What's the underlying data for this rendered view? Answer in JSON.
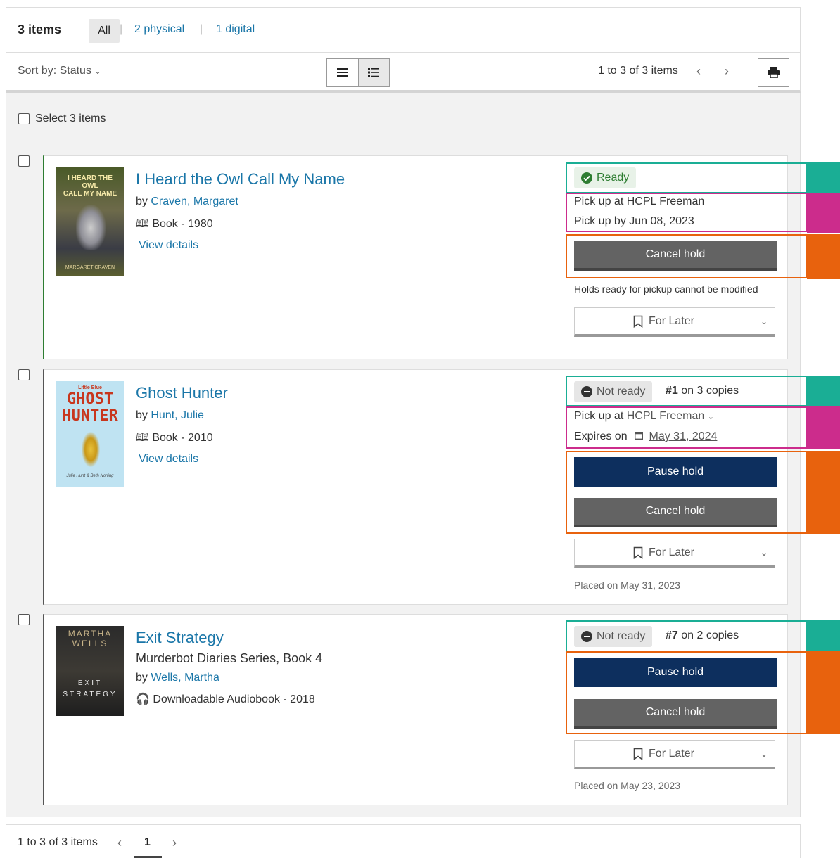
{
  "header": {
    "count": "3 items",
    "filters": {
      "all": "All",
      "physical": "2 physical",
      "digital": "1 digital"
    },
    "sort_label": "Sort by: Status",
    "pagination": "1 to 3 of 3 items"
  },
  "select_all": "Select 3 items",
  "items": [
    {
      "title": "I Heard the Owl Call My Name",
      "by": "by",
      "author": "Craven, Margaret",
      "format": "Book - 1980",
      "view_details": "View details",
      "status": "Ready",
      "pickup": "Pick up at HCPL Freeman",
      "pickup_by": "Pick up by Jun 08, 2023",
      "cancel": "Cancel hold",
      "note": "Holds ready for pickup cannot be modified",
      "for_later": "For Later",
      "cover_text": {
        "top": "I HEARD THE OWL",
        "mid": "CALL MY NAME",
        "bottom": "MARGARET CRAVEN"
      }
    },
    {
      "title": "Ghost Hunter",
      "by": "by",
      "author": "Hunt, Julie",
      "format": "Book - 2010",
      "view_details": "View details",
      "status": "Not ready",
      "queue_num": "#1",
      "queue_rest": "on 3 copies",
      "pickup_prefix": "Pick up at",
      "pickup_location": "HCPL Freeman",
      "expires_label": "Expires on",
      "expires_date": "May 31, 2024",
      "pause": "Pause hold",
      "cancel": "Cancel hold",
      "for_later": "For Later",
      "placed": "Placed on May 31, 2023",
      "cover_text": {
        "series": "Little Blue",
        "line1": "GHOST",
        "line2": "HUNTER",
        "credit": "Julie Hunt & Beth Norling"
      }
    },
    {
      "title": "Exit Strategy",
      "series": "Murderbot Diaries Series, Book 4",
      "by": "by",
      "author": "Wells, Martha",
      "format": "Downloadable Audiobook - 2018",
      "status": "Not ready",
      "queue_num": "#7",
      "queue_rest": "on 2 copies",
      "pause": "Pause hold",
      "cancel": "Cancel hold",
      "for_later": "For Later",
      "placed": "Placed on May 23, 2023",
      "cover_text": {
        "author1": "MARTHA",
        "author2": "WELLS",
        "line1": "EXIT",
        "line2": "STRATEGY"
      }
    }
  ],
  "footer": {
    "pagination": "1 to 3 of 3 items",
    "page": "1"
  },
  "colors": {
    "link": "#1a76a8",
    "navy_button": "#0d2f5e",
    "gray_button": "#636363",
    "teal": "#1aae95",
    "magenta": "#cc2c8c",
    "orange": "#e8620d",
    "ready_green": "#2e7d32"
  }
}
